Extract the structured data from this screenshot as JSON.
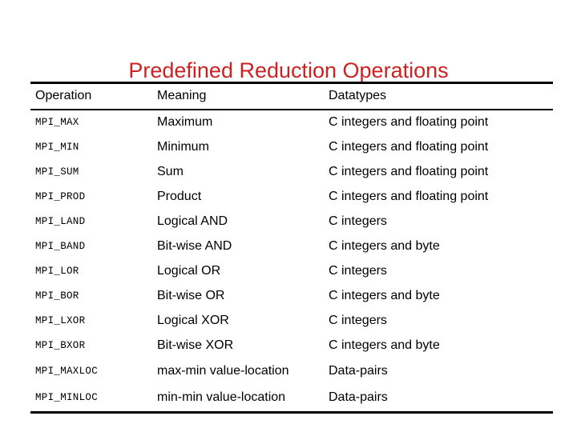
{
  "slide": {
    "title": "Predefined Reduction Operations",
    "title_color": "#cc2222",
    "background_color": "#ffffff",
    "text_color": "#000000",
    "rule_color": "#000000"
  },
  "table": {
    "headers": {
      "operation": "Operation",
      "meaning": "Meaning",
      "datatypes": "Datatypes"
    },
    "rows": [
      {
        "operation": "MPI_MAX",
        "meaning": "Maximum",
        "datatypes": "C integers and floating point"
      },
      {
        "operation": "MPI_MIN",
        "meaning": "Minimum",
        "datatypes": "C integers and floating point"
      },
      {
        "operation": "MPI_SUM",
        "meaning": "Sum",
        "datatypes": "C integers and floating point"
      },
      {
        "operation": "MPI_PROD",
        "meaning": "Product",
        "datatypes": "C integers and floating point"
      },
      {
        "operation": "MPI_LAND",
        "meaning": "Logical AND",
        "datatypes": "C integers"
      },
      {
        "operation": "MPI_BAND",
        "meaning": "Bit-wise AND",
        "datatypes": "C integers and byte"
      },
      {
        "operation": "MPI_LOR",
        "meaning": "Logical OR",
        "datatypes": "C integers"
      },
      {
        "operation": "MPI_BOR",
        "meaning": "Bit-wise OR",
        "datatypes": "C integers and byte"
      },
      {
        "operation": "MPI_LXOR",
        "meaning": "Logical XOR",
        "datatypes": "C integers"
      },
      {
        "operation": "MPI_BXOR",
        "meaning": "Bit-wise XOR",
        "datatypes": "C integers and byte"
      },
      {
        "operation": "MPI_MAXLOC",
        "meaning": "max-min value-location",
        "datatypes": "Data-pairs"
      },
      {
        "operation": "MPI_MINLOC",
        "meaning": "min-min value-location",
        "datatypes": "Data-pairs"
      }
    ]
  }
}
